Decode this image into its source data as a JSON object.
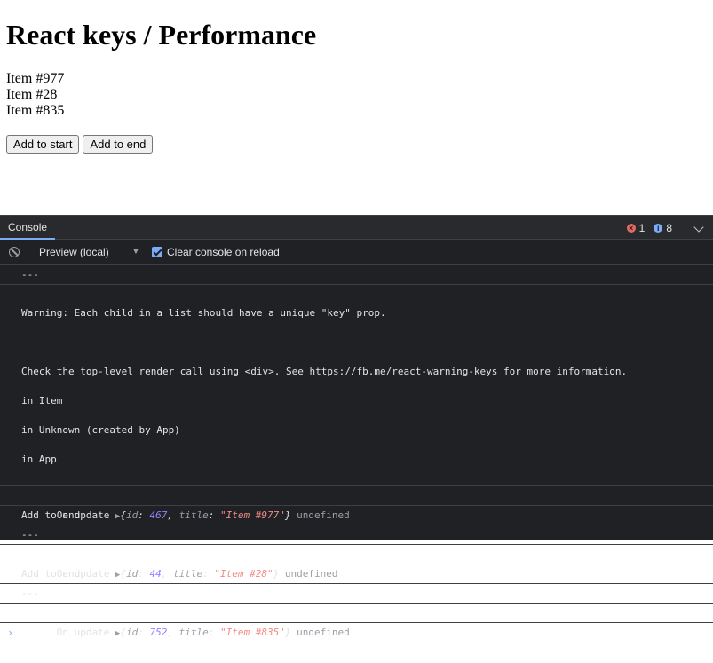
{
  "preview": {
    "title": "React keys / Performance",
    "items": [
      "Item #977",
      "Item #28",
      "Item #835"
    ],
    "buttons": {
      "add_start": "Add to start",
      "add_end": "Add to end"
    }
  },
  "devtools": {
    "tab_label": "Console",
    "error_count": "1",
    "info_count": "8",
    "context_select": "Preview (local)",
    "clear_on_reload_label": "Clear console on reload",
    "clear_on_reload_checked": true,
    "colors": {
      "accent": "#7cacf8",
      "error": "#e46962",
      "background": "#202124"
    }
  },
  "console": {
    "separator": "---",
    "warning": {
      "line1": "Warning: Each child in a list should have a unique \"key\" prop.",
      "line2": "Check the top-level render call using <div>. See https://fb.me/react-warning-keys for more information.",
      "line3": "in Item",
      "line4": "in Unknown (created by App)",
      "line5": "in App"
    },
    "updates": [
      {
        "label": "On update",
        "id": "467",
        "title": "\"Item #977\"",
        "suffix": "undefined"
      },
      {
        "label": "On update",
        "id": "44",
        "title": "\"Item #28\"",
        "suffix": "undefined"
      },
      {
        "label": "On update",
        "id": "752",
        "title": "\"Item #835\"",
        "suffix": "undefined"
      }
    ],
    "action_label": "Add to end",
    "obj_key_id": "id",
    "obj_key_title": "title",
    "prompt_glyph": "›"
  }
}
